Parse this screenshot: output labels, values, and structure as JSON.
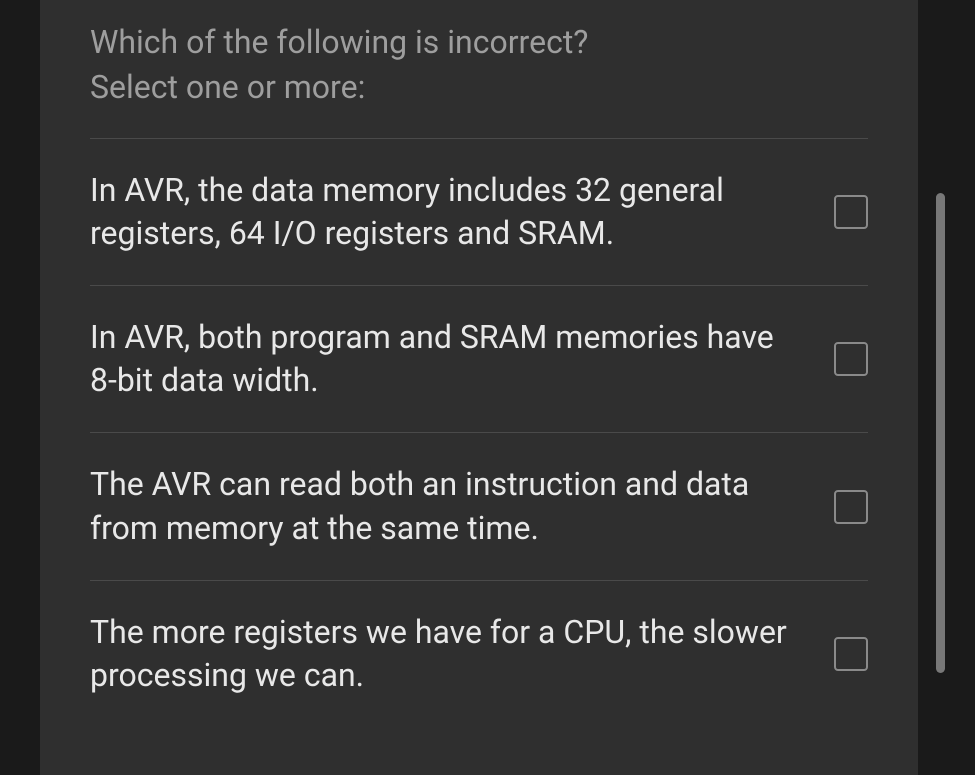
{
  "question": {
    "prompt": "Which of the following is incorrect?",
    "instruction": "Select one or more:"
  },
  "options": [
    {
      "text": "In AVR, the data memory includes 32 general registers, 64 I/O registers and SRAM."
    },
    {
      "text": "In AVR, both program and SRAM memories have 8-bit data width."
    },
    {
      "text": "The AVR can read both an instruction and data from memory at the same time."
    },
    {
      "text": "The more registers we have for a CPU, the slower processing we can."
    }
  ]
}
